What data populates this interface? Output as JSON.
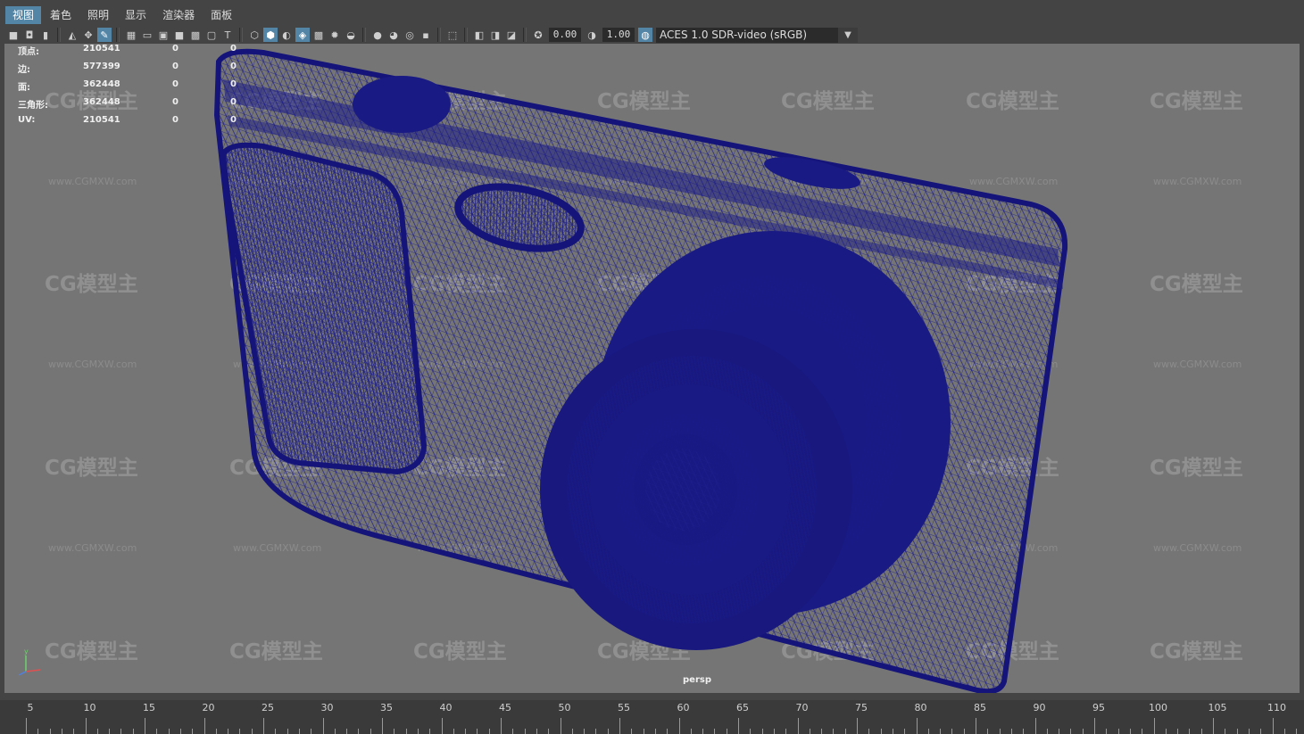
{
  "menu": [
    "视图",
    "着色",
    "照明",
    "显示",
    "渲染器",
    "面板"
  ],
  "toolbar": {
    "gamma_value": "0.00",
    "exposure_value": "1.00",
    "color_management": "ACES 1.0 SDR-video (sRGB)"
  },
  "hud": [
    {
      "label": "顶点:",
      "values": [
        "210541",
        "0",
        "0"
      ]
    },
    {
      "label": "边:",
      "values": [
        "577399",
        "0",
        "0"
      ]
    },
    {
      "label": "面:",
      "values": [
        "362448",
        "0",
        "0"
      ]
    },
    {
      "label": "三角形:",
      "values": [
        "362448",
        "0",
        "0"
      ]
    },
    {
      "label": "UV:",
      "values": [
        "210541",
        "0",
        "0"
      ]
    }
  ],
  "camera": "persp",
  "watermark": {
    "logo": "CG模型主",
    "url": "www.CGMXW.com"
  },
  "timeline": {
    "labels": [
      "5",
      "10",
      "15",
      "20",
      "25",
      "30",
      "35",
      "40",
      "45",
      "50",
      "55",
      "60",
      "65",
      "70",
      "75",
      "80",
      "85",
      "90",
      "95",
      "100",
      "105",
      "110"
    ]
  },
  "colors": {
    "viewport_bg": "#757575",
    "wireframe": "#1a1a8a",
    "menu_active": "#5285a6"
  }
}
